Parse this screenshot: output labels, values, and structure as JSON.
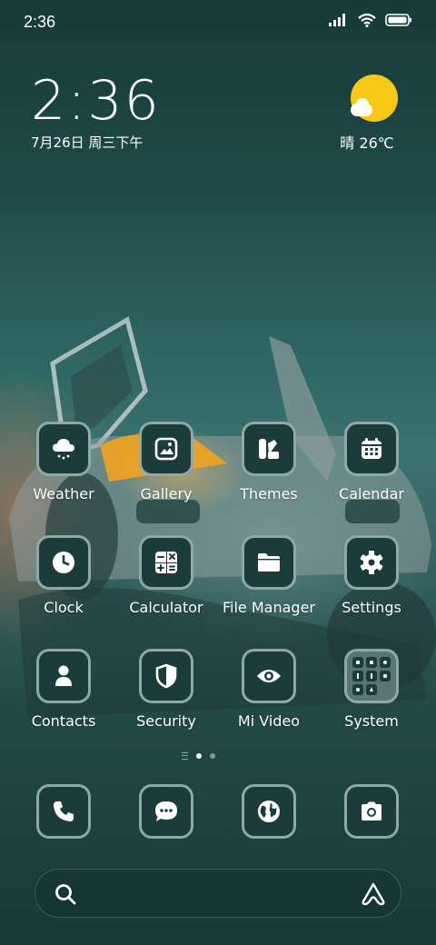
{
  "status_bar": {
    "time": "2:36",
    "icons": [
      "signal-icon",
      "wifi-icon",
      "battery-icon"
    ]
  },
  "clock_widget": {
    "time": "2:36",
    "date": "7月26日 周三下午"
  },
  "weather_widget": {
    "condition": "晴",
    "temperature": "26℃",
    "icon": "sunny-cloud-icon"
  },
  "apps": [
    {
      "label": "Weather",
      "icon": "weather-icon"
    },
    {
      "label": "Gallery",
      "icon": "gallery-icon"
    },
    {
      "label": "Themes",
      "icon": "themes-icon"
    },
    {
      "label": "Calendar",
      "icon": "calendar-icon"
    },
    {
      "label": "Clock",
      "icon": "clock-icon"
    },
    {
      "label": "Calculator",
      "icon": "calculator-icon"
    },
    {
      "label": "File Manager",
      "icon": "folder-icon"
    },
    {
      "label": "Settings",
      "icon": "gear-icon"
    },
    {
      "label": "Contacts",
      "icon": "person-icon"
    },
    {
      "label": "Security",
      "icon": "shield-icon"
    },
    {
      "label": "Mi Video",
      "icon": "eye-icon"
    },
    {
      "label": "System",
      "icon": "folder-grid-icon"
    }
  ],
  "page_indicator": {
    "pages": 2,
    "current": 1
  },
  "dock": [
    {
      "icon": "phone-icon"
    },
    {
      "icon": "chat-icon"
    },
    {
      "icon": "globe-icon"
    },
    {
      "icon": "camera-icon"
    }
  ],
  "search_bar": {
    "left_icon": "search-icon",
    "right_icon": "assistant-icon"
  },
  "colors": {
    "icon_bg": "#1c3c3b",
    "icon_border": "#8fa9a6",
    "sun": "#f7c914"
  }
}
